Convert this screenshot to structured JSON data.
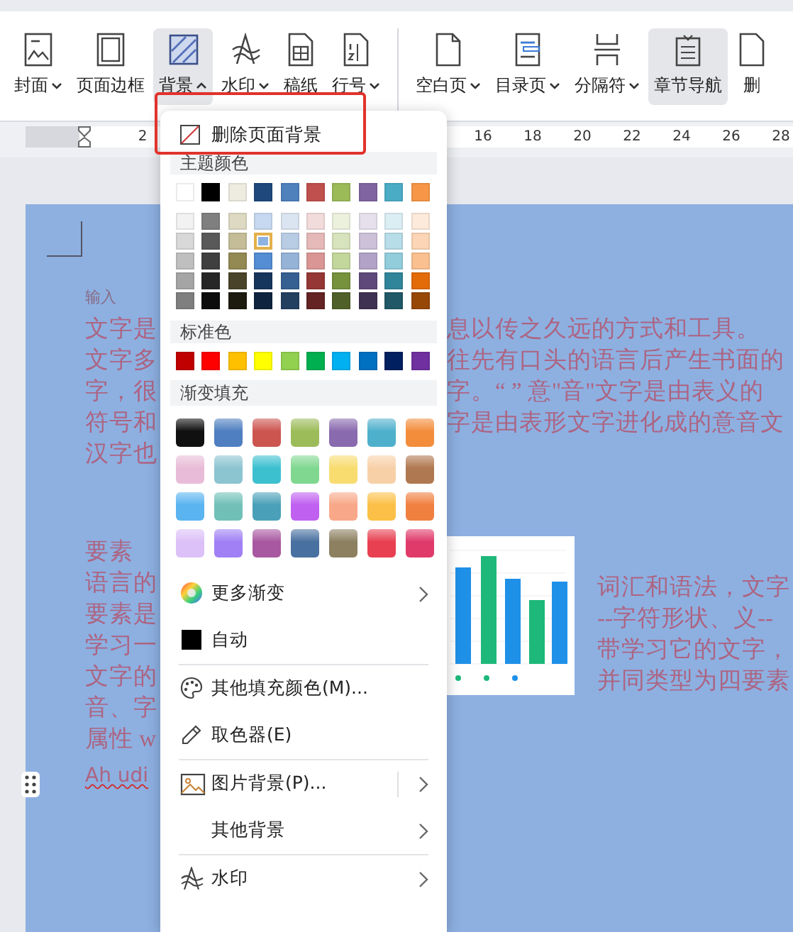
{
  "toolbar": [
    {
      "items": [
        {
          "label": "封面",
          "has_menu": true,
          "expanded": false,
          "selected": false
        },
        {
          "label": "页面边框",
          "has_menu": false,
          "expanded": false,
          "selected": false
        },
        {
          "label": "背景",
          "has_menu": true,
          "expanded": true,
          "selected": true
        },
        {
          "label": "水印",
          "has_menu": true,
          "expanded": false,
          "selected": false
        },
        {
          "label": "稿纸",
          "has_menu": false,
          "expanded": false,
          "selected": false
        },
        {
          "label": "行号",
          "has_menu": true,
          "expanded": false,
          "selected": false
        }
      ]
    },
    {
      "items": [
        {
          "label": "空白页",
          "has_menu": true,
          "expanded": false,
          "selected": false
        },
        {
          "label": "目录页",
          "has_menu": true,
          "expanded": false,
          "selected": false
        },
        {
          "label": "分隔符",
          "has_menu": true,
          "expanded": false,
          "selected": false
        },
        {
          "label": "章节导航",
          "has_menu": false,
          "expanded": false,
          "selected": true
        },
        {
          "label": "删",
          "has_menu": false,
          "expanded": false,
          "selected": false
        }
      ]
    }
  ],
  "ruler": {
    "labels": [
      "2",
      "16",
      "18",
      "20",
      "22",
      "24",
      "26",
      "28"
    ]
  },
  "document": {
    "input_hint": "输入",
    "upper_left": [
      "文字是",
      "文字多",
      "字，很",
      "符号和",
      "汉字也"
    ],
    "upper_right": [
      "息以传之久远的方式和工具。",
      "往先有口头的语言后产生书面的",
      "字。“ ” 意\"音\"文字是由表义的",
      "字是由表形文字进化成的意音文"
    ],
    "heading": "要素",
    "lower_left": [
      "语言的",
      "要素是",
      "学习一",
      "文字的",
      "音、字",
      "属性 w"
    ],
    "latin_line": "Ah udi",
    "lower_right": [
      "词汇和语法，文字",
      "--字符形状、义--",
      "带学习它的文字，",
      "并同类型为四要素"
    ]
  },
  "menu": {
    "remove_label": "删除页面背景",
    "theme_title": "主题颜色",
    "theme_colors": [
      {
        "color": "#ffffff",
        "selected": false
      },
      {
        "color": "#000000",
        "selected": false
      },
      {
        "color": "#eeece1",
        "selected": false
      },
      {
        "color": "#1f497d",
        "selected": false
      },
      {
        "color": "#4f81bd",
        "selected": false
      },
      {
        "color": "#c0504d",
        "selected": false
      },
      {
        "color": "#9bbb59",
        "selected": false
      },
      {
        "color": "#8064a2",
        "selected": false
      },
      {
        "color": "#4bacc6",
        "selected": false
      },
      {
        "color": "#f79646",
        "selected": false
      }
    ],
    "theme_shades": [
      [
        {
          "color": "#f2f2f2",
          "selected": false
        },
        {
          "color": "#7f7f7f",
          "selected": false
        },
        {
          "color": "#ddd9c3",
          "selected": false
        },
        {
          "color": "#c6d9f0",
          "selected": false
        },
        {
          "color": "#dbe5f1",
          "selected": false
        },
        {
          "color": "#f2dcdb",
          "selected": false
        },
        {
          "color": "#ebf1dd",
          "selected": false
        },
        {
          "color": "#e5e0ec",
          "selected": false
        },
        {
          "color": "#dbeef3",
          "selected": false
        },
        {
          "color": "#fdeada",
          "selected": false
        }
      ],
      [
        {
          "color": "#d8d8d8",
          "selected": false
        },
        {
          "color": "#595959",
          "selected": false
        },
        {
          "color": "#c4bd97",
          "selected": false
        },
        {
          "color": "#8db3e2",
          "selected": true
        },
        {
          "color": "#b8cce4",
          "selected": false
        },
        {
          "color": "#e5b9b7",
          "selected": false
        },
        {
          "color": "#d7e3bc",
          "selected": false
        },
        {
          "color": "#ccc1d9",
          "selected": false
        },
        {
          "color": "#b7dde8",
          "selected": false
        },
        {
          "color": "#fbd5b5",
          "selected": false
        }
      ],
      [
        {
          "color": "#bfbfbf",
          "selected": false
        },
        {
          "color": "#3f3f3f",
          "selected": false
        },
        {
          "color": "#938953",
          "selected": false
        },
        {
          "color": "#548dd4",
          "selected": false
        },
        {
          "color": "#95b3d7",
          "selected": false
        },
        {
          "color": "#d99694",
          "selected": false
        },
        {
          "color": "#c3d69b",
          "selected": false
        },
        {
          "color": "#b2a2c7",
          "selected": false
        },
        {
          "color": "#92cddc",
          "selected": false
        },
        {
          "color": "#fac08f",
          "selected": false
        }
      ],
      [
        {
          "color": "#a5a5a5",
          "selected": false
        },
        {
          "color": "#262626",
          "selected": false
        },
        {
          "color": "#494429",
          "selected": false
        },
        {
          "color": "#17365d",
          "selected": false
        },
        {
          "color": "#366092",
          "selected": false
        },
        {
          "color": "#953734",
          "selected": false
        },
        {
          "color": "#76923c",
          "selected": false
        },
        {
          "color": "#5f497a",
          "selected": false
        },
        {
          "color": "#31859b",
          "selected": false
        },
        {
          "color": "#e36c09",
          "selected": false
        }
      ],
      [
        {
          "color": "#7f7f7f",
          "selected": false
        },
        {
          "color": "#0c0c0c",
          "selected": false
        },
        {
          "color": "#1d1b10",
          "selected": false
        },
        {
          "color": "#0f243e",
          "selected": false
        },
        {
          "color": "#244061",
          "selected": false
        },
        {
          "color": "#632423",
          "selected": false
        },
        {
          "color": "#4f6128",
          "selected": false
        },
        {
          "color": "#3f3151",
          "selected": false
        },
        {
          "color": "#205867",
          "selected": false
        },
        {
          "color": "#974806",
          "selected": false
        }
      ]
    ],
    "standard_title": "标准色",
    "standard_colors": [
      {
        "color": "#c00000",
        "selected": false
      },
      {
        "color": "#ff0000",
        "selected": false
      },
      {
        "color": "#ffc000",
        "selected": false
      },
      {
        "color": "#ffff00",
        "selected": false
      },
      {
        "color": "#92d050",
        "selected": false
      },
      {
        "color": "#00b050",
        "selected": false
      },
      {
        "color": "#00b0f0",
        "selected": false
      },
      {
        "color": "#0070c0",
        "selected": false
      },
      {
        "color": "#002060",
        "selected": false
      },
      {
        "color": "#7030a0",
        "selected": false
      }
    ],
    "gradient_title": "渐变填充",
    "gradients": [
      [
        {
          "color": "#101010",
          "selected": false
        },
        {
          "color": "#4f7fc0",
          "selected": false
        },
        {
          "color": "#cc5550",
          "selected": false
        },
        {
          "color": "#9cbc5a",
          "selected": false
        },
        {
          "color": "#8a6aae",
          "selected": false
        },
        {
          "color": "#4fb0cc",
          "selected": false
        },
        {
          "color": "#f38d3c",
          "selected": false
        }
      ],
      [
        {
          "color": "#e8bcd8",
          "selected": false
        },
        {
          "color": "#8cc4d0",
          "selected": false
        },
        {
          "color": "#3cc0d0",
          "selected": false
        },
        {
          "color": "#80d890",
          "selected": false
        },
        {
          "color": "#f8dc70",
          "selected": false
        },
        {
          "color": "#f8d0a8",
          "selected": false
        },
        {
          "color": "#b07850",
          "selected": false
        }
      ],
      [
        {
          "color": "#5ab4f0",
          "selected": false
        },
        {
          "color": "#70c0b8",
          "selected": false
        },
        {
          "color": "#4aa0b8",
          "selected": false
        },
        {
          "color": "#c060f0",
          "selected": false
        },
        {
          "color": "#f8a888",
          "selected": false
        },
        {
          "color": "#fcc048",
          "selected": false
        },
        {
          "color": "#f08040",
          "selected": false
        }
      ],
      [
        {
          "color": "#dcc0f8",
          "selected": false
        },
        {
          "color": "#a080f4",
          "selected": false
        },
        {
          "color": "#a858a0",
          "selected": false
        },
        {
          "color": "#4870a0",
          "selected": false
        },
        {
          "color": "#8c8060",
          "selected": false
        },
        {
          "color": "#e84050",
          "selected": false
        },
        {
          "color": "#e03a6a",
          "selected": false
        }
      ]
    ],
    "items": [
      {
        "label": "更多渐变",
        "has_submenu": true,
        "split": false,
        "divider_before": false
      },
      {
        "label": "自动",
        "has_submenu": false,
        "split": false,
        "divider_before": false
      },
      {
        "label": "其他填充颜色(M)...",
        "has_submenu": false,
        "split": false,
        "divider_before": true
      },
      {
        "label": "取色器(E)",
        "has_submenu": false,
        "split": false,
        "divider_before": false
      },
      {
        "label": "图片背景(P)...",
        "has_submenu": true,
        "split": true,
        "divider_before": true
      },
      {
        "label": "其他背景",
        "has_submenu": true,
        "split": false,
        "divider_before": false
      },
      {
        "label": "水印",
        "has_submenu": true,
        "split": false,
        "divider_before": true
      }
    ]
  }
}
